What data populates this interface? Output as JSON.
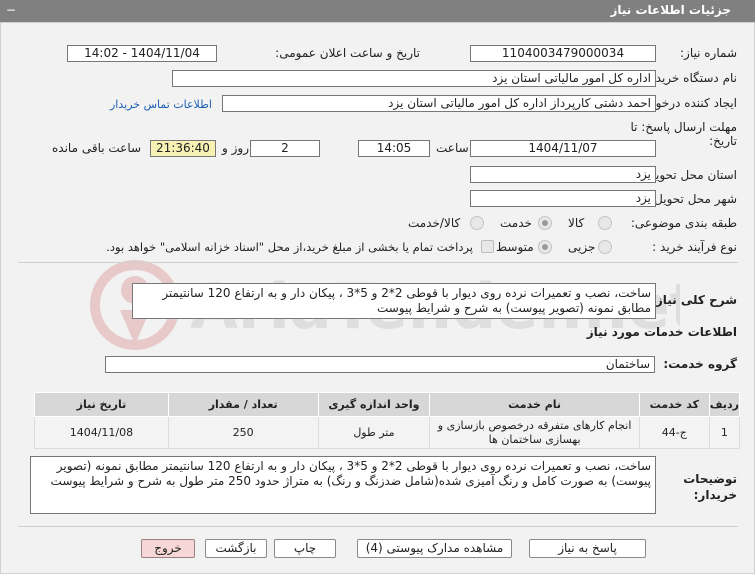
{
  "header": {
    "title": "جزئیات اطلاعات نیاز",
    "toggle": "−"
  },
  "fields": {
    "need_number": {
      "label": "شماره نیاز:",
      "value": "1104003479000034"
    },
    "announce_datetime": {
      "label": "تاریخ و ساعت اعلان عمومی:",
      "value": "1404/11/04 - 14:02"
    },
    "buyer_org": {
      "label": "نام دستگاه خریدار:",
      "value": "اداره کل امور مالیاتی استان یزد"
    },
    "creator": {
      "label": "ایجاد کننده درخواست:",
      "value": "احمد دشتی کارپرداز اداره کل امور مالیاتی استان یزد",
      "link": "اطلاعات تماس خریدار"
    },
    "deadline": {
      "label_line1": "مهلت ارسال پاسخ: تا",
      "label_line2": "تاریخ:",
      "date": "1404/11/07",
      "time_label": "ساعت",
      "time": "14:05",
      "days": "2",
      "days_label": "روز و",
      "remaining": "21:36:40",
      "remaining_label": "ساعت باقی مانده"
    },
    "province": {
      "label": "استان محل تحویل:",
      "value": "یزد"
    },
    "city": {
      "label": "شهر محل تحویل:",
      "value": "یزد"
    },
    "category": {
      "label": "طبقه بندی موضوعی:",
      "options": [
        "کالا",
        "خدمت",
        "کالا/خدمت"
      ],
      "selected": "خدمت"
    },
    "process": {
      "label": "نوع فرآیند خرید :",
      "options": [
        "جزیی",
        "متوسط"
      ],
      "selected": "متوسط",
      "payment_note": "پرداخت تمام یا بخشی از مبلغ خرید،از محل \"اسناد خزانه اسلامی\" خواهد بود."
    }
  },
  "summary": {
    "label": "شرح کلی نیاز:",
    "text": "ساخت، نصب و تعمیرات نرده روی دیوار با قوطی 2*2 و 5*3 ، پیکان دار و به ارتفاع 120 سانتیمتر مطابق نمونه (تصویر پیوست) به شرح و شرایط پیوست"
  },
  "services": {
    "section_title": "اطلاعات خدمات مورد نیاز",
    "group_label": "گروه خدمت:",
    "group_value": "ساختمان",
    "columns": [
      "ردیف",
      "کد خدمت",
      "نام خدمت",
      "واحد اندازه گیری",
      "تعداد / مقدار",
      "تاریخ نیاز"
    ],
    "rows": [
      {
        "row": "1",
        "code": "ج-44",
        "name": "انجام کارهای متفرقه درخصوص بازسازی و بهسازی ساختمان ها",
        "unit": "متر طول",
        "qty": "250",
        "date": "1404/11/08"
      }
    ]
  },
  "buyer_notes": {
    "label_line1": "توضیحات",
    "label_line2": "خریدار:",
    "text": "ساخت، نصب و تعمیرات نرده روی دیوار با قوطی 2*2 و 5*3 ، پیکان دار و به ارتفاع 120 سانتیمتر مطابق نمونه (تصویر پیوست) به صورت کامل و رنگ آمیزی شده(شامل ضدزنگ و رنگ) به متراژ حدود 250 متر طول به شرح و شرایط پیوست"
  },
  "actions": {
    "reply": "پاسخ به نیاز",
    "attachments": "مشاهده مدارک پیوستی (4)",
    "print": "چاپ",
    "back": "بازگشت",
    "exit": "خروج"
  },
  "watermark": {
    "text": "AriaTender.net"
  },
  "colors": {
    "titlebar": "#808080",
    "panel": "#f2f2f2",
    "highlight": "#f7f2b4",
    "exit_button": "#f6d6d6",
    "link": "#1a5fb4"
  }
}
